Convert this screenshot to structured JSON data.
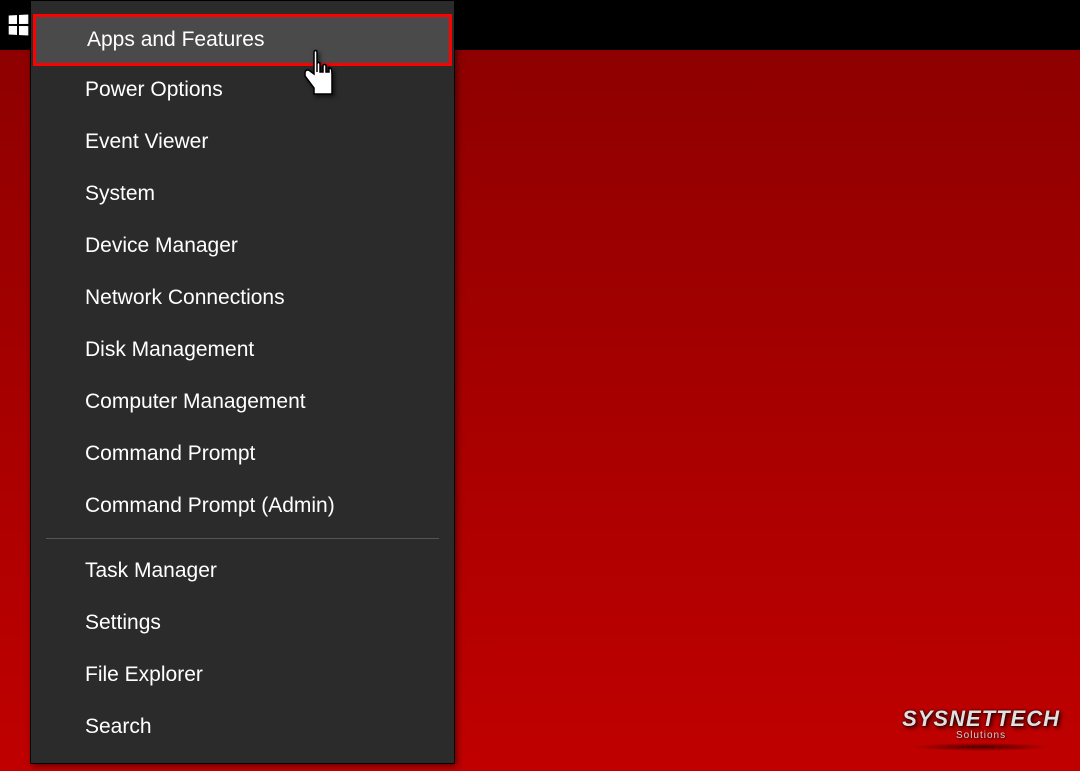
{
  "menu": {
    "group1": [
      {
        "label": "Apps and Features",
        "highlighted": true
      },
      {
        "label": "Power Options",
        "highlighted": false
      },
      {
        "label": "Event Viewer",
        "highlighted": false
      },
      {
        "label": "System",
        "highlighted": false
      },
      {
        "label": "Device Manager",
        "highlighted": false
      },
      {
        "label": "Network Connections",
        "highlighted": false
      },
      {
        "label": "Disk Management",
        "highlighted": false
      },
      {
        "label": "Computer Management",
        "highlighted": false
      },
      {
        "label": "Command Prompt",
        "highlighted": false
      },
      {
        "label": "Command Prompt (Admin)",
        "highlighted": false
      }
    ],
    "group2": [
      {
        "label": "Task Manager",
        "highlighted": false
      },
      {
        "label": "Settings",
        "highlighted": false
      },
      {
        "label": "File Explorer",
        "highlighted": false
      },
      {
        "label": "Search",
        "highlighted": false
      }
    ]
  },
  "watermark": {
    "main": "SYSNETTECH",
    "sub": "Solutions"
  }
}
